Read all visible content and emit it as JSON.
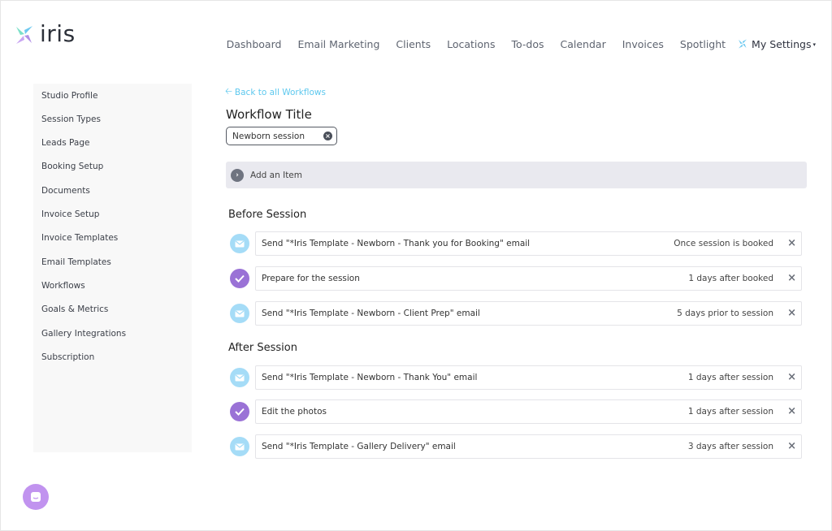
{
  "brand": {
    "name": "iris",
    "accent": "#5dc8ee",
    "purple": "#9a72d6"
  },
  "nav": {
    "items": [
      "Dashboard",
      "Email Marketing",
      "Clients",
      "Locations",
      "To-dos",
      "Calendar",
      "Invoices",
      "Spotlight"
    ],
    "settings_label": "My Settings",
    "settings_icon": "pinwheel-icon",
    "settings_caret": "▾"
  },
  "sidebar": {
    "items": [
      "Studio Profile",
      "Session Types",
      "Leads Page",
      "Booking Setup",
      "Documents",
      "Invoice Setup",
      "Invoice Templates",
      "Email Templates",
      "Workflows",
      "Goals & Metrics",
      "Gallery Integrations",
      "Subscription"
    ]
  },
  "main": {
    "back_link": "Back to all Workflows",
    "title_label": "Workflow Title",
    "title_value": "Newborn session",
    "add_item_label": "Add an Item",
    "sections": [
      {
        "title": "Before Session",
        "rows": [
          {
            "icon": "envelope-icon",
            "kind": "email",
            "desc": "Send \"*Iris Template - Newborn - Thank you for Booking\" email",
            "timing": "Once session is booked"
          },
          {
            "icon": "check-icon",
            "kind": "task",
            "desc": "Prepare for the session",
            "timing": "1 days after booked"
          },
          {
            "icon": "envelope-icon",
            "kind": "email",
            "desc": "Send \"*Iris Template - Newborn - Client Prep\" email",
            "timing": "5 days prior to session"
          }
        ]
      },
      {
        "title": "After Session",
        "rows": [
          {
            "icon": "envelope-icon",
            "kind": "email",
            "desc": "Send \"*Iris Template - Newborn - Thank You\" email",
            "timing": "1 days after session"
          },
          {
            "icon": "check-icon",
            "kind": "task",
            "desc": "Edit the photos",
            "timing": "1 days after session"
          },
          {
            "icon": "envelope-icon",
            "kind": "email",
            "desc": "Send \"*Iris Template - Gallery Delivery\" email",
            "timing": "3 days after session"
          }
        ]
      }
    ]
  }
}
